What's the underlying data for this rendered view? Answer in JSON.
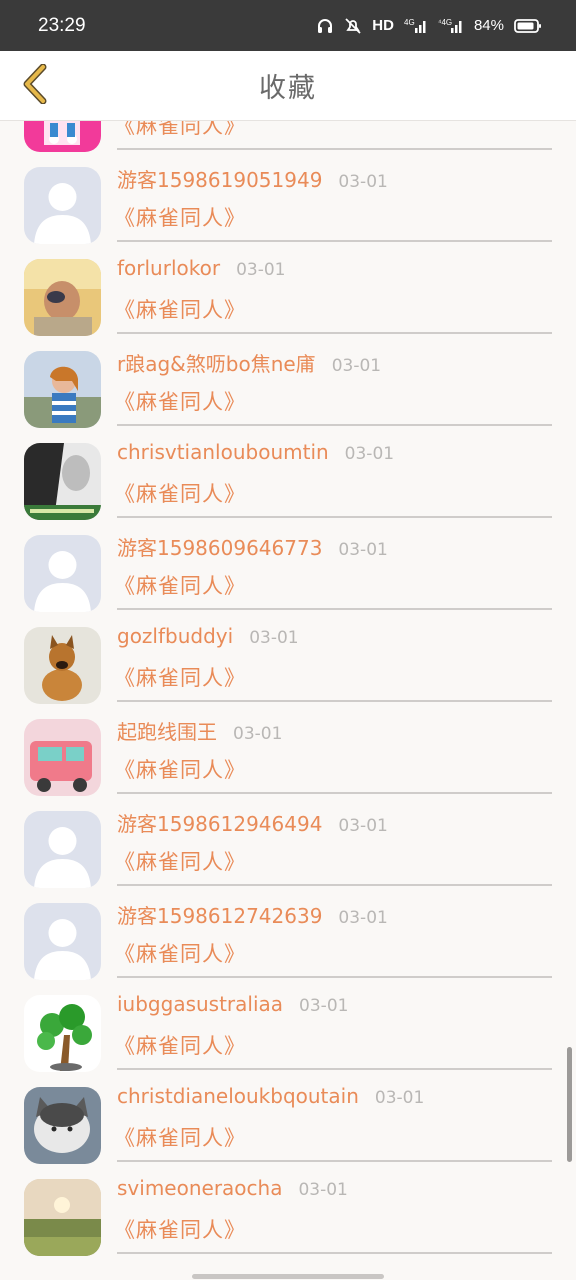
{
  "status_bar": {
    "time": "23:29",
    "hd_label": "HD",
    "battery_percent": "84%",
    "icons": [
      "headphones-icon",
      "mute-icon",
      "hd-icon",
      "signal-4g-icon",
      "signal-4g-icon",
      "battery-icon"
    ]
  },
  "header": {
    "title": "收藏",
    "back_icon": "chevron-left-icon",
    "accent_color": "#e6b84a"
  },
  "colors": {
    "name": "#e98b58",
    "date": "#b9b7b5",
    "background": "#faf8f6"
  },
  "favorites": [
    {
      "name": "",
      "date": "",
      "work": "《麻雀同人》",
      "avatar": "pink-character"
    },
    {
      "name": "游客1598619051949",
      "date": "03-01",
      "work": "《麻雀同人》",
      "avatar": "default-person"
    },
    {
      "name": "forlurlokor",
      "date": "03-01",
      "work": "《麻雀同人》",
      "avatar": "photo-person"
    },
    {
      "name": "r踉ag&煞呖bo焦ne庯",
      "date": "03-01",
      "work": "《麻雀同人》",
      "avatar": "girl-photo"
    },
    {
      "name": "chrisvtianlouboumtin",
      "date": "03-01",
      "work": "《麻雀同人》",
      "avatar": "bw-photo"
    },
    {
      "name": "游客1598609646773",
      "date": "03-01",
      "work": "《麻雀同人》",
      "avatar": "default-person"
    },
    {
      "name": "gozlfbuddyi",
      "date": "03-01",
      "work": "《麻雀同人》",
      "avatar": "dog-photo"
    },
    {
      "name": "起跑线围王",
      "date": "03-01",
      "work": "《麻雀同人》",
      "avatar": "pink-truck"
    },
    {
      "name": "游客1598612946494",
      "date": "03-01",
      "work": "《麻雀同人》",
      "avatar": "default-person"
    },
    {
      "name": "游客1598612742639",
      "date": "03-01",
      "work": "《麻雀同人》",
      "avatar": "default-person"
    },
    {
      "name": "iubggasustraliaa",
      "date": "03-01",
      "work": "《麻雀同人》",
      "avatar": "bonsai-tree"
    },
    {
      "name": "christdianeloukbqoutain",
      "date": "03-01",
      "work": "《麻雀同人》",
      "avatar": "cat-photo"
    },
    {
      "name": "svimeoneraocha",
      "date": "03-01",
      "work": "《麻雀同人》",
      "avatar": "sunset-field"
    }
  ]
}
